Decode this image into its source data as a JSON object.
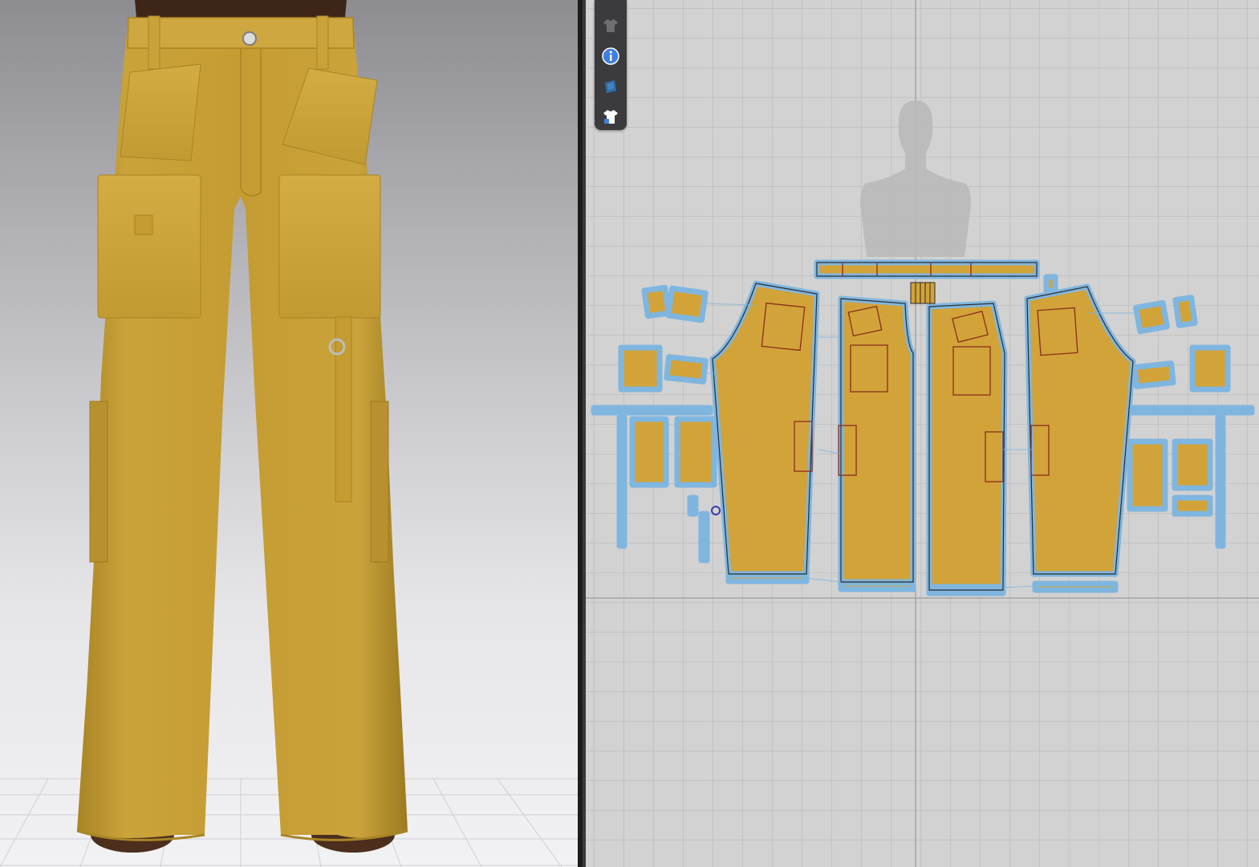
{
  "app": {
    "panels": [
      "3d-view",
      "2d-pattern-view"
    ]
  },
  "toolbar": {
    "buttons": [
      {
        "name": "garment-shirt",
        "icon": "shirt-icon",
        "active": false
      },
      {
        "name": "info",
        "icon": "info-icon",
        "active": true
      },
      {
        "name": "fabric-texture",
        "icon": "texture-icon",
        "active": false
      },
      {
        "name": "garment-lock",
        "icon": "shirt-lock-icon",
        "active": false
      }
    ]
  },
  "colors": {
    "fabric": "#c9a23a",
    "fabric_dark": "#a98424",
    "pattern_fill": "#d2a338",
    "pattern_outline": "#7fb6e0",
    "seam_line": "#8a2d1e",
    "grid_bg": "#d2d2d2",
    "toolbar_bg": "#3b3b3e",
    "info_blue": "#3f7fe0"
  }
}
